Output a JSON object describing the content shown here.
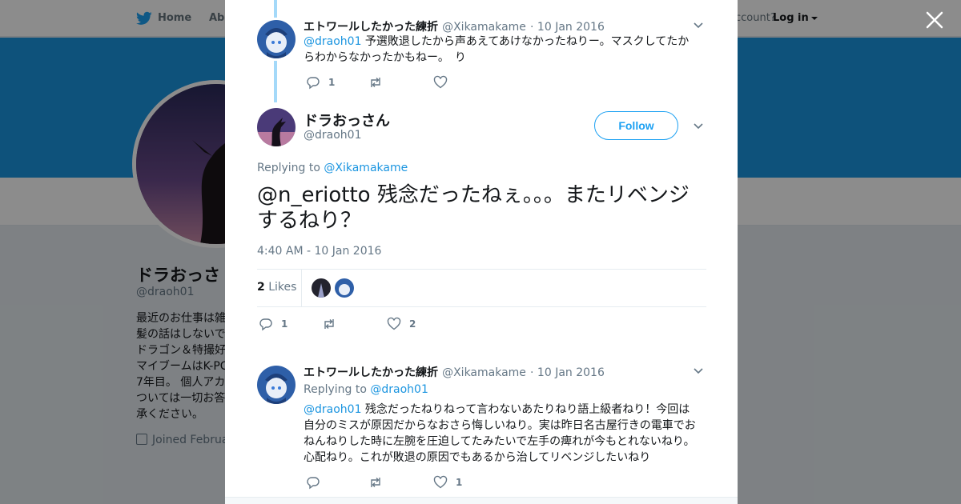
{
  "nav": {
    "home": "Home",
    "about": "Abo",
    "account_prompt": "ccount?",
    "login": "Log in"
  },
  "profile": {
    "name": "ドラおっさ",
    "handle": "@draoh01",
    "bio": "最近のお仕事は雑\n髪の話はしないで\nドラゴン＆特撮好\nマイブームはK-PC\n7年目。 個人アカ\nついては一切お答\n承ください。",
    "joined": "Joined Februa"
  },
  "thread": {
    "prev_tweet": {
      "name": "エトワールしたかった練折",
      "handle": "@Xikamakame",
      "date": "· 10 Jan 2016",
      "mention": "@draoh01",
      "text": " 予選敗退したから声あえてあけなかったねりー。マスクしてたからわからなかったかもねー。　り",
      "reply_count": "1"
    },
    "main_tweet": {
      "name": "ドラおっさん",
      "handle": "@draoh01",
      "follow_label": "Follow",
      "replying_prefix": "Replying to ",
      "replying_to": "@Xikamakame",
      "text": "@n_eriotto 残念だったねぇ。。。またリベンジするねり？",
      "timestamp": "4:40 AM - 10 Jan 2016",
      "likes_count": "2",
      "likes_label": "Likes",
      "reply_count": "1",
      "like_count": "2"
    },
    "reply_tweet": {
      "name": "エトワールしたかった練折",
      "handle": "@Xikamakame",
      "date": "· 10 Jan 2016",
      "replying_prefix": "Replying to ",
      "replying_to": "@draoh01",
      "mention": "@draoh01",
      "text": " 残念だったねりねって言わないあたりねり語上級者ねり！今回は自分のミスが原因だからなおさら悔しいねり。実は昨日名古屋行きの電車でおねんねりした時に左腕を圧迫してたみたいで左手の痺れが今もとれないねり。心配ねり。これが敗退の原因でもあるから治してリベンジしたいねり",
      "like_count": "1"
    }
  },
  "icons": [
    "twitter-bird-icon",
    "close-icon",
    "reply-icon",
    "retweet-icon",
    "heart-icon",
    "chevron-down-icon",
    "calendar-icon"
  ],
  "colors": {
    "accent": "#1da1f2",
    "link": "#1b95e0",
    "thread_line": "#a4d9f9",
    "cover": "#1b95e0"
  }
}
